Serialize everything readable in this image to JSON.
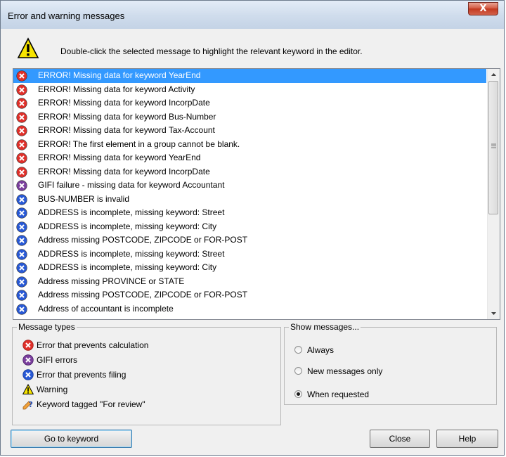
{
  "window": {
    "title": "Error and warning messages",
    "close_glyph": "X"
  },
  "header": {
    "icon": "warning-icon",
    "text": "Double-click the selected message to highlight the relevant keyword in the editor."
  },
  "messages": [
    {
      "type": "error",
      "text": "ERROR! Missing data for keyword YearEnd",
      "selected": true
    },
    {
      "type": "error",
      "text": "ERROR! Missing data for keyword Activity"
    },
    {
      "type": "error",
      "text": "ERROR! Missing data for keyword IncorpDate"
    },
    {
      "type": "error",
      "text": "ERROR! Missing data for keyword Bus-Number"
    },
    {
      "type": "error",
      "text": "ERROR! Missing data for keyword Tax-Account"
    },
    {
      "type": "error",
      "text": "ERROR! The first element in a group cannot be blank."
    },
    {
      "type": "error",
      "text": "ERROR! Missing data for keyword YearEnd"
    },
    {
      "type": "error",
      "text": "ERROR! Missing data for keyword IncorpDate"
    },
    {
      "type": "gifi",
      "text": "GIFI failure - missing data for keyword Accountant"
    },
    {
      "type": "filing",
      "text": "BUS-NUMBER  is invalid"
    },
    {
      "type": "filing",
      "text": "ADDRESS is incomplete, missing keyword: Street"
    },
    {
      "type": "filing",
      "text": "ADDRESS is incomplete, missing keyword: City"
    },
    {
      "type": "filing",
      "text": "Address missing POSTCODE, ZIPCODE or FOR-POST"
    },
    {
      "type": "filing",
      "text": "ADDRESS is incomplete, missing keyword: Street"
    },
    {
      "type": "filing",
      "text": "ADDRESS is incomplete, missing keyword: City"
    },
    {
      "type": "filing",
      "text": "Address missing PROVINCE or STATE"
    },
    {
      "type": "filing",
      "text": "Address missing POSTCODE, ZIPCODE or FOR-POST"
    },
    {
      "type": "filing",
      "text": "Address of accountant is incomplete"
    }
  ],
  "scrollbar": {
    "position": 0.0
  },
  "message_types": {
    "label": "Message types",
    "items": [
      {
        "icon": "error-icon",
        "label": "Error that prevents calculation"
      },
      {
        "icon": "gifi-error-icon",
        "label": "GIFI errors"
      },
      {
        "icon": "filing-error-icon",
        "label": "Error that prevents filing"
      },
      {
        "icon": "warning-icon",
        "label": "Warning"
      },
      {
        "icon": "review-icon",
        "label": "Keyword tagged \"For review\""
      }
    ]
  },
  "show_messages": {
    "label": "Show messages...",
    "options": [
      {
        "label": "Always",
        "selected": false
      },
      {
        "label": "New messages only",
        "selected": false
      },
      {
        "label": "When requested",
        "selected": true
      }
    ]
  },
  "buttons": {
    "goto": "Go to keyword",
    "close": "Close",
    "help": "Help"
  },
  "colors": {
    "error": "#e0302a",
    "gifi": "#7b3f9e",
    "filing": "#2859d6",
    "selection": "#3399ff",
    "warning": "#f7e400"
  }
}
